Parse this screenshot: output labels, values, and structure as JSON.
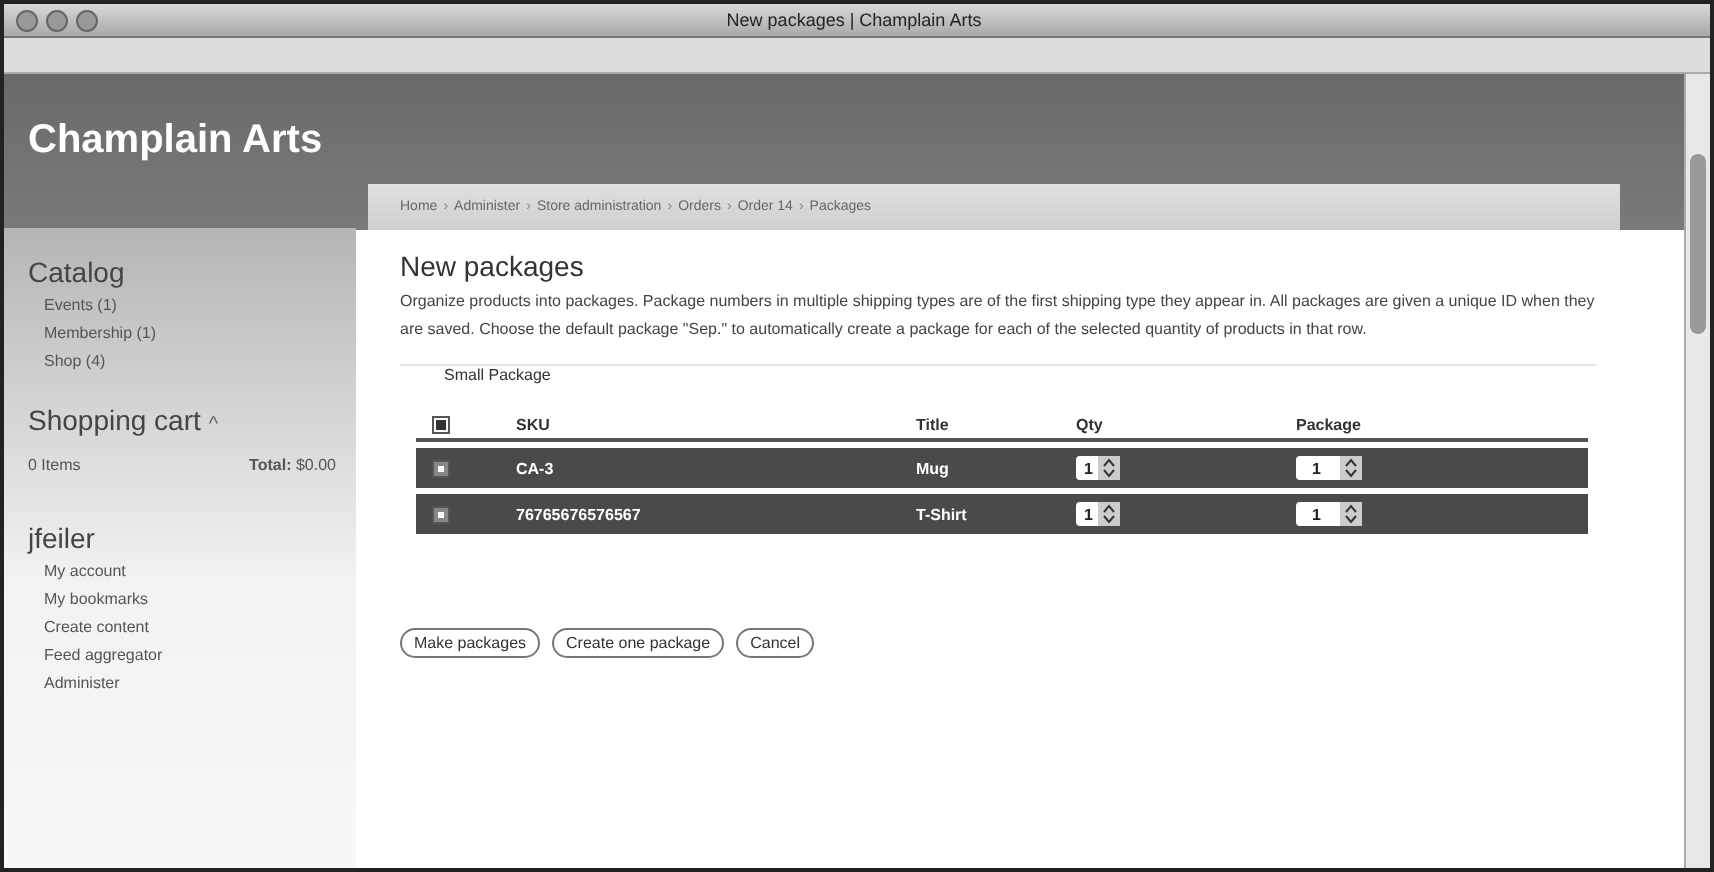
{
  "window": {
    "title": "New packages | Champlain Arts"
  },
  "site_name": "Champlain Arts",
  "breadcrumb_separator": "›",
  "breadcrumb": [
    "Home",
    "Administer",
    "Store administration",
    "Orders",
    "Order 14",
    "Packages"
  ],
  "sidebar": {
    "catalog": {
      "title": "Catalog",
      "items": [
        "Events (1)",
        "Membership (1)",
        "Shop (4)"
      ]
    },
    "cart": {
      "title": "Shopping cart",
      "toggle": "^",
      "items": "0 Items",
      "total_label": "Total:",
      "total": "$0.00"
    },
    "user": {
      "title": "jfeiler",
      "items": [
        "My account",
        "My bookmarks",
        "Create content",
        "Feed aggregator",
        "Administer"
      ]
    }
  },
  "page": {
    "title": "New packages",
    "description": "Organize products into packages. Package numbers in multiple shipping types are of the first shipping type they appear in. All packages are given a unique ID when they are saved. Choose the default package \"Sep.\" to automatically create a package for each of the selected quantity of products in that row.",
    "fieldset": "Small Package",
    "table": {
      "all_checked": true,
      "columns": [
        "SKU",
        "Title",
        "Qty",
        "Package"
      ],
      "rows": [
        {
          "checked": true,
          "sku": "CA-3",
          "title": "Mug",
          "qty": "1",
          "package": "1"
        },
        {
          "checked": true,
          "sku": "76765676576567",
          "title": "T-Shirt",
          "qty": "1",
          "package": "1"
        }
      ]
    },
    "buttons": [
      "Make packages",
      "Create one package",
      "Cancel"
    ]
  }
}
